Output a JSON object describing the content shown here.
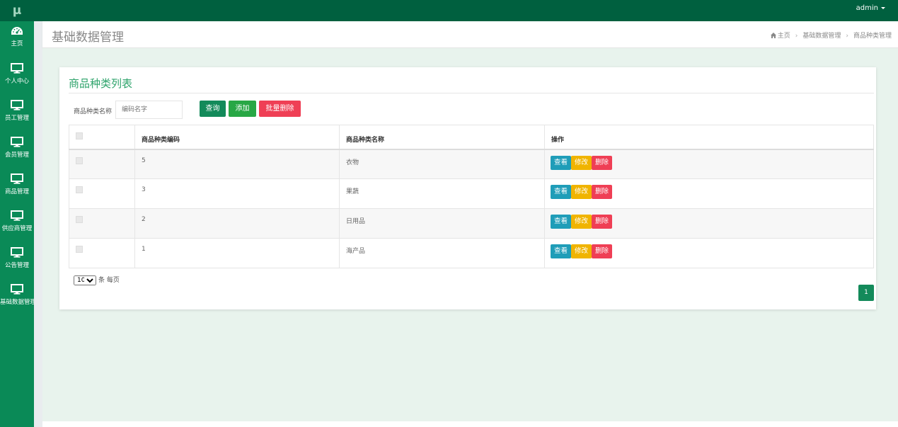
{
  "app": {
    "logo": "μ",
    "user": "admin"
  },
  "sidebar": {
    "items": [
      {
        "label": "主页",
        "icon": "dashboard-icon"
      },
      {
        "label": "个人中心",
        "icon": "monitor-icon"
      },
      {
        "label": "员工管理",
        "icon": "monitor-icon"
      },
      {
        "label": "会员管理",
        "icon": "monitor-icon"
      },
      {
        "label": "商品管理",
        "icon": "monitor-icon"
      },
      {
        "label": "供应商管理",
        "icon": "monitor-icon"
      },
      {
        "label": "公告管理",
        "icon": "monitor-icon"
      },
      {
        "label": "基础数据管理",
        "icon": "monitor-icon"
      }
    ]
  },
  "header": {
    "title": "基础数据管理",
    "breadcrumb": [
      "主页",
      "基础数据管理",
      "商品种类管理"
    ]
  },
  "panel": {
    "title": "商品种类列表",
    "search_label": "商品种类名称",
    "search_placeholder": "编码名字",
    "query_label": "查询",
    "add_label": "添加",
    "batch_delete_label": "批量删除"
  },
  "table": {
    "headers": [
      "商品种类编码",
      "商品种类名称",
      "操作"
    ],
    "rows": [
      {
        "code": "5",
        "name": "衣物"
      },
      {
        "code": "3",
        "name": "果蔬"
      },
      {
        "code": "2",
        "name": "日用品"
      },
      {
        "code": "1",
        "name": "海产品"
      }
    ],
    "actions": {
      "view": "查看",
      "edit": "修改",
      "delete": "删除"
    }
  },
  "pagination": {
    "page_size": "10",
    "page_size_suffix": "条 每页",
    "current_page": "1"
  },
  "colors": {
    "topbar": "#00603f",
    "sidebar": "#0a8a57",
    "accent": "#138a5a",
    "danger": "#ef3f55",
    "warning": "#f0b400",
    "info": "#1f9db8"
  }
}
